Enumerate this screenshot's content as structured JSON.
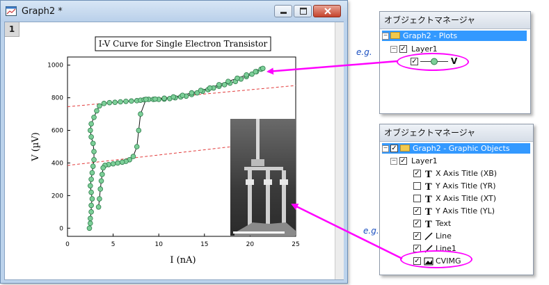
{
  "window": {
    "title": "Graph2 *",
    "layer_number": "1"
  },
  "chart_data": {
    "type": "scatter",
    "title": "I-V Curve for Single Electron Transistor",
    "xlabel": "I (nA)",
    "ylabel": "V (µV)",
    "xlim": [
      0,
      25
    ],
    "ylim": [
      -50,
      1050
    ],
    "xticks": [
      "0",
      "5",
      "10",
      "15",
      "20",
      "25"
    ],
    "yticks": [
      "0",
      "200",
      "400",
      "600",
      "800",
      "1000"
    ],
    "series": [
      {
        "name": "V",
        "x": [
          2.4,
          2.5,
          2.5,
          2.6,
          2.6,
          2.7,
          2.6,
          2.5,
          2.6,
          2.7,
          2.8,
          2.9,
          2.9,
          2.8,
          2.6,
          2.5,
          2.6,
          2.9,
          3.2,
          3.5,
          4.0,
          4.6,
          5.2,
          5.8,
          6.4,
          7.0,
          7.6,
          8.0,
          8.4,
          8.9,
          9.4,
          10.0,
          10.6,
          11.2,
          11.8,
          12.4,
          13.0,
          13.6,
          14.2,
          14.8,
          15.4,
          16.0,
          16.6,
          17.2,
          17.8,
          18.4,
          19.0,
          19.6,
          20.2,
          20.7,
          21.2,
          21.4,
          20.6,
          19.6,
          18.6,
          17.6,
          16.6,
          15.6,
          14.6,
          13.6,
          12.6,
          11.6,
          10.6,
          9.6,
          8.6,
          8.0,
          7.8,
          7.6,
          7.2,
          6.8,
          6.4,
          6.0,
          5.5,
          5.0,
          4.5,
          4.1,
          3.9,
          3.8,
          3.7,
          3.6,
          3.5,
          3.4
        ],
        "y": [
          0,
          30,
          60,
          100,
          140,
          180,
          220,
          260,
          300,
          340,
          380,
          420,
          470,
          520,
          560,
          600,
          640,
          680,
          720,
          750,
          765,
          770,
          772,
          775,
          778,
          780,
          782,
          785,
          788,
          790,
          790,
          790,
          792,
          795,
          800,
          805,
          810,
          820,
          830,
          840,
          850,
          860,
          870,
          880,
          890,
          900,
          915,
          930,
          945,
          960,
          975,
          980,
          960,
          940,
          920,
          900,
          880,
          860,
          845,
          830,
          815,
          805,
          797,
          792,
          790,
          700,
          600,
          500,
          440,
          420,
          410,
          405,
          400,
          395,
          390,
          385,
          370,
          330,
          290,
          240,
          180,
          130
        ],
        "color": "#7ccf98",
        "edge_color": "#2d7a4a"
      }
    ],
    "trend_lines": [
      {
        "x": [
          0,
          25
        ],
        "y": [
          745,
          875
        ],
        "color": "#e23b3b",
        "style": "dashed"
      },
      {
        "x": [
          0,
          25
        ],
        "y": [
          385,
          545
        ],
        "color": "#e23b3b",
        "style": "dashed"
      }
    ],
    "grid": false
  },
  "plots_manager": {
    "header": "オブジェクトマネージャ",
    "root": "Graph2 - Plots",
    "layer": "Layer1",
    "plot_label": "V",
    "eg": "e.g."
  },
  "graphics_manager": {
    "header": "オブジェクトマネージャ",
    "root": "Graph2 - Graphic Objects",
    "layer": "Layer1",
    "eg": "e.g.",
    "items": [
      {
        "label": "X Axis Title (XB)",
        "checked": true,
        "icon": "T"
      },
      {
        "label": "Y Axis Title (YR)",
        "checked": false,
        "icon": "T"
      },
      {
        "label": "X Axis Title (XT)",
        "checked": false,
        "icon": "T"
      },
      {
        "label": "Y Axis Title (YL)",
        "checked": true,
        "icon": "T"
      },
      {
        "label": "Text",
        "checked": true,
        "icon": "T"
      },
      {
        "label": "Line",
        "checked": true,
        "icon": "line"
      },
      {
        "label": "Line1",
        "checked": true,
        "icon": "line"
      },
      {
        "label": "CVIMG",
        "checked": true,
        "icon": "image"
      }
    ]
  },
  "colors": {
    "highlight": "#ff00ff",
    "selection": "#3399ff"
  }
}
